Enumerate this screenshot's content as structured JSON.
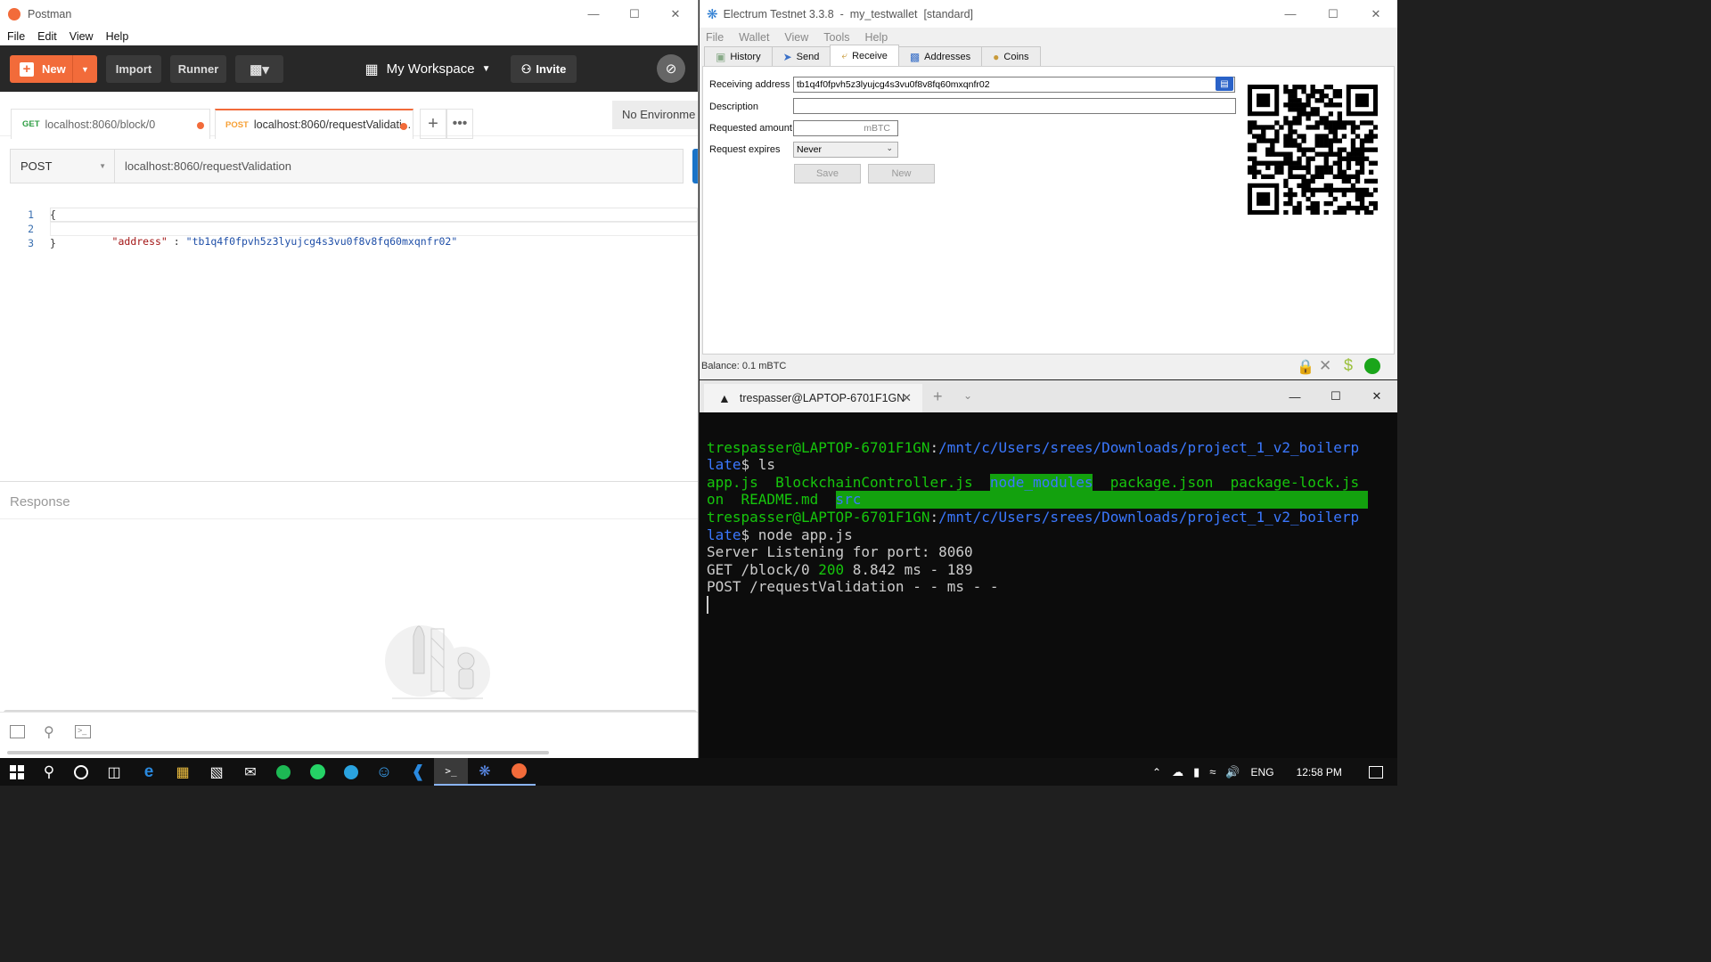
{
  "postman": {
    "title": "Postman",
    "menu": [
      "File",
      "Edit",
      "View",
      "Help"
    ],
    "new_label": "New",
    "import_label": "Import",
    "runner_label": "Runner",
    "workspace_label": "My Workspace",
    "invite_label": "Invite",
    "tabs": [
      {
        "method": "GET",
        "url": "localhost:8060/block/0"
      },
      {
        "method": "POST",
        "url": "localhost:8060/requestValidati..."
      }
    ],
    "environment": "No Environme",
    "request_method": "POST",
    "request_url": "localhost:8060/requestValidation",
    "body_lines": [
      {
        "num": "1",
        "text": "{"
      },
      {
        "num": "2",
        "key": "\"address\"",
        "sep": " : ",
        "value": "\"tb1q4f0fpvh5z3lyujcg4s3vu0f8v8fq60mxqnfr02\""
      },
      {
        "num": "3",
        "text": "}"
      }
    ],
    "response_label": "Response"
  },
  "electrum": {
    "title": "Electrum Testnet 3.3.8  -  my_testwallet  [standard]",
    "menu": [
      "File",
      "Wallet",
      "View",
      "Tools",
      "Help"
    ],
    "tabs": [
      "History",
      "Send",
      "Receive",
      "Addresses",
      "Coins"
    ],
    "receiving_address_label": "Receiving address",
    "receiving_address": "tb1q4f0fpvh5z3lyujcg4s3vu0f8v8fq60mxqnfr02",
    "description_label": "Description",
    "description": "",
    "requested_amount_label": "Requested amount",
    "amount_unit": "mBTC",
    "request_expires_label": "Request expires",
    "expires_value": "Never",
    "save_label": "Save",
    "new_label": "New",
    "balance": "Balance: 0.1 mBTC"
  },
  "terminal": {
    "tab_title": "trespasser@LAPTOP-6701F1GN",
    "user_host": "trespasser@LAPTOP-6701F1GN",
    "path_1": "/mnt/c/Users/srees/Downloads/project_1_v2_boilerp",
    "path_2": "late",
    "cmd1": "$ ls",
    "files": {
      "app": "app.js",
      "controller": "BlockchainController.js",
      "node_modules": "node_modules",
      "package": "package.json",
      "lock_a": "package-lock.js",
      "lock_b": "on",
      "readme": "README.md",
      "src": "src"
    },
    "cmd2": "$ node app.js",
    "out_listen": "Server Listening for port: 8060",
    "out_get_a": "GET /block/0 ",
    "out_get_code": "200",
    "out_get_b": " 8.842 ms - 189",
    "out_post": "POST /requestValidation - - ms - -"
  },
  "taskbar": {
    "lang": "ENG",
    "time": "12:58 PM"
  },
  "colors": {
    "postman_orange": "#f26b3a",
    "terminal_green": "#16c60c",
    "terminal_blue": "#3b78ff"
  }
}
